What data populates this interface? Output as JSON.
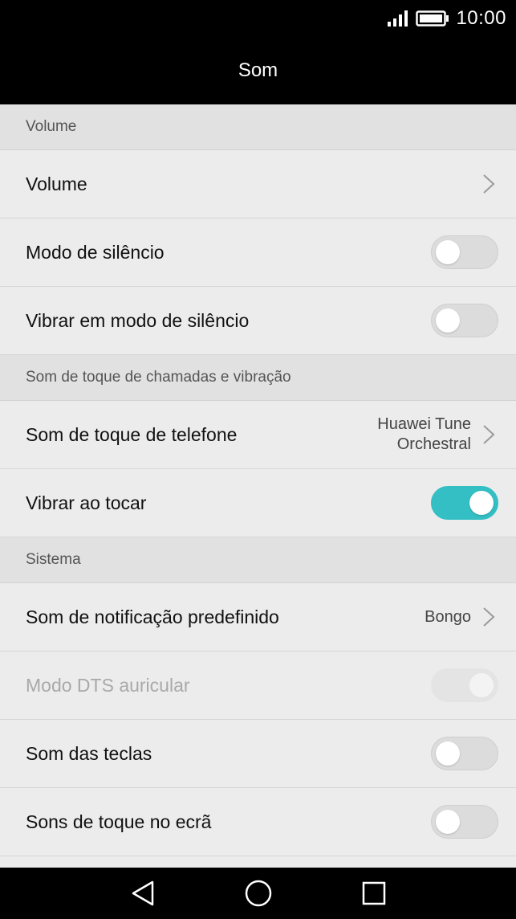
{
  "status_bar": {
    "time": "10:00",
    "icons": [
      "signal-icon",
      "battery-icon"
    ]
  },
  "header": {
    "title": "Som"
  },
  "sections": {
    "volume": {
      "header": "Volume",
      "items": {
        "volume": {
          "label": "Volume"
        },
        "silent_mode": {
          "label": "Modo de silêncio",
          "enabled": false
        },
        "vibrate_silent": {
          "label": "Vibrar em modo de silêncio",
          "enabled": false
        }
      }
    },
    "ringtone": {
      "header": "Som de toque de chamadas e vibração",
      "items": {
        "phone_ringtone": {
          "label": "Som de toque de telefone",
          "value_line1": "Huawei Tune",
          "value_line2": "Orchestral"
        },
        "vibrate_ring": {
          "label": "Vibrar ao tocar",
          "enabled": true
        }
      }
    },
    "system": {
      "header": "Sistema",
      "items": {
        "notification_sound": {
          "label": "Som de notificação predefinido",
          "value": "Bongo"
        },
        "dts_mode": {
          "label": "Modo DTS auricular",
          "enabled": true,
          "disabled": true
        },
        "key_sounds": {
          "label": "Som das teclas",
          "enabled": false
        },
        "touch_sounds": {
          "label": "Sons de toque no ecrã",
          "enabled": false
        }
      }
    }
  },
  "colors": {
    "accent": "#33bfc4",
    "background": "#ececec",
    "section_header": "#e1e1e1"
  },
  "nav_bar": {
    "icons": [
      "back-icon",
      "home-icon",
      "recents-icon"
    ]
  }
}
